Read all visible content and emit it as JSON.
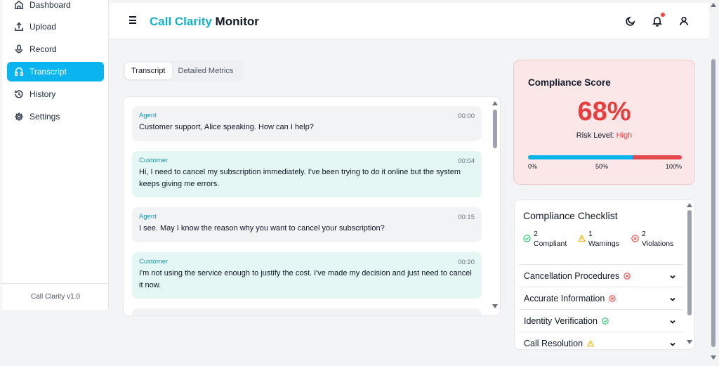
{
  "sidebar": {
    "items": [
      {
        "label": "Dashboard",
        "icon": "home-icon"
      },
      {
        "label": "Upload",
        "icon": "upload-icon"
      },
      {
        "label": "Record",
        "icon": "microphone-icon"
      },
      {
        "label": "Transcript",
        "icon": "transcript-icon",
        "active": true
      },
      {
        "label": "History",
        "icon": "history-icon"
      },
      {
        "label": "Settings",
        "icon": "gear-icon"
      }
    ],
    "footer": "Call Clarity v1.0"
  },
  "header": {
    "title_part1": "Call Clarity",
    "title_part2": "Monitor",
    "icons": [
      "menu-icon",
      "moon-icon",
      "bell-icon",
      "user-icon"
    ]
  },
  "tabs": [
    {
      "label": "Transcript",
      "active": true
    },
    {
      "label": "Detailed Metrics",
      "active": false
    }
  ],
  "transcript": {
    "messages": [
      {
        "speaker": "Agent",
        "time": "00:00",
        "text": "Customer support, Alice speaking. How can I help?"
      },
      {
        "speaker": "Customer",
        "time": "00:04",
        "text": "Hi, I need to cancel my subscription immediately. I've been trying to do it online but the system keeps giving me errors."
      },
      {
        "speaker": "Agent",
        "time": "00:15",
        "text": "I see. May I know the reason why you want to cancel your subscription?"
      },
      {
        "speaker": "Customer",
        "time": "00:20",
        "text": "I'm not using the service enough to justify the cost. I've made my decision and just need to cancel it now."
      }
    ]
  },
  "score": {
    "title": "Compliance Score",
    "value": "68%",
    "risk_label": "Risk Level:",
    "risk_level": "High",
    "progress_fraction": 0.68,
    "bar_labels": [
      "0%",
      "50%",
      "100%"
    ],
    "colors": {
      "value": "#e53e3e",
      "bar_blue": "#0ab4ef",
      "bar_red": "#e5484d"
    }
  },
  "checklist": {
    "title": "Compliance Checklist",
    "stats": [
      {
        "count": "2",
        "label": "Compliant",
        "icon": "check-circle-icon",
        "color": "#22c55e"
      },
      {
        "count": "1",
        "label": "Warnings",
        "icon": "warning-icon",
        "color": "#eab308"
      },
      {
        "count": "2",
        "label": "Violations",
        "icon": "x-circle-icon",
        "color": "#ef4444"
      }
    ],
    "items": [
      {
        "label": "Cancellation Procedures",
        "status": "violation"
      },
      {
        "label": "Accurate Information",
        "status": "violation"
      },
      {
        "label": "Identity Verification",
        "status": "compliant"
      },
      {
        "label": "Call Resolution",
        "status": "warning"
      }
    ]
  }
}
